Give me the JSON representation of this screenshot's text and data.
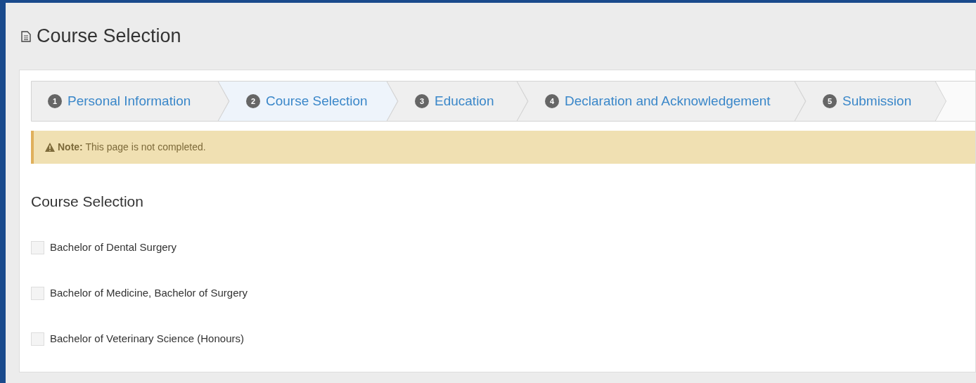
{
  "page": {
    "title": "Course Selection"
  },
  "steps": [
    {
      "number": "1",
      "label": "Personal Information",
      "selected": false
    },
    {
      "number": "2",
      "label": "Course Selection",
      "selected": true
    },
    {
      "number": "3",
      "label": "Education",
      "selected": false
    },
    {
      "number": "4",
      "label": "Declaration and Acknowledgement",
      "selected": false
    },
    {
      "number": "5",
      "label": "Submission",
      "selected": false
    }
  ],
  "alert": {
    "text": "**Note:** This page is not completed."
  },
  "section": {
    "heading": "Course Selection"
  },
  "courses": [
    {
      "label": "Bachelor of Dental Surgery",
      "checked": false
    },
    {
      "label": "Bachelor of Medicine, Bachelor of Surgery",
      "checked": false
    },
    {
      "label": "Bachelor of Veterinary Science (Honours)",
      "checked": false
    }
  ]
}
